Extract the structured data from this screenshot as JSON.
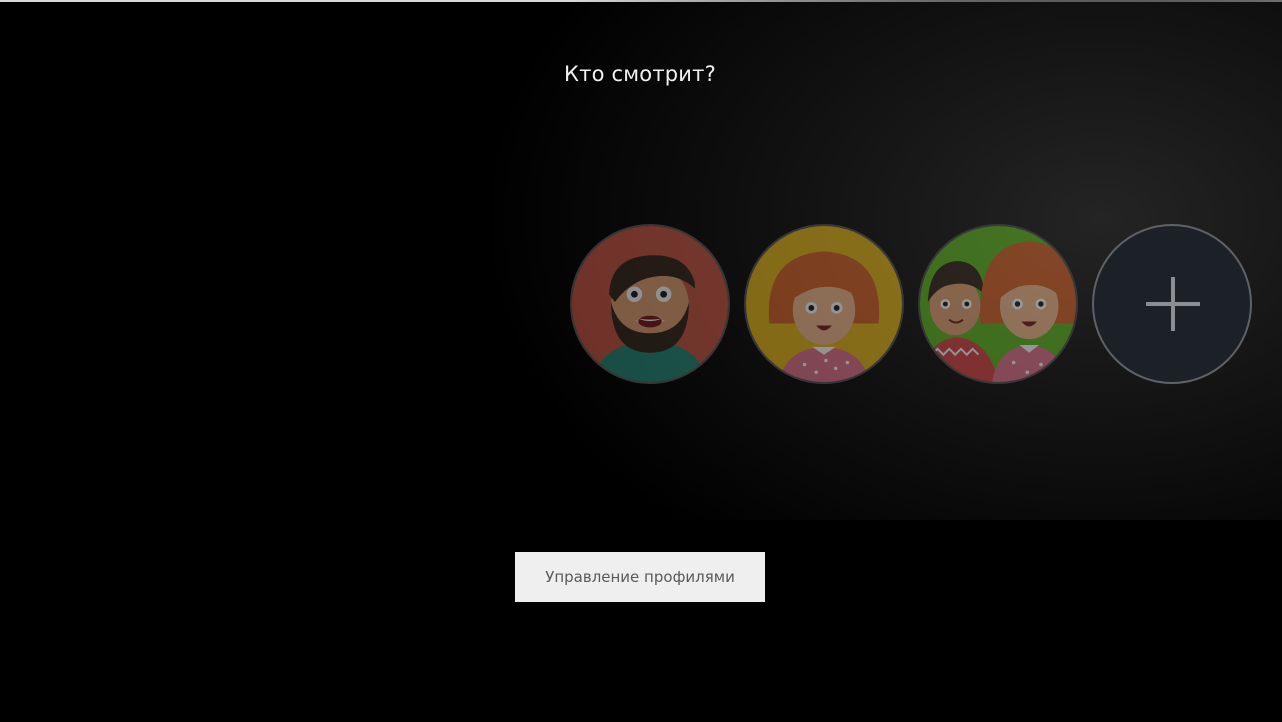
{
  "screen": {
    "title": "Кто смотрит?",
    "manage_button_label": "Управление профилями"
  },
  "profiles": [
    {
      "icon": "bearded-man-avatar-icon",
      "bg_color": "#b04a3c"
    },
    {
      "icon": "red-haired-woman-avatar-icon",
      "bg_color": "#c9a01a"
    },
    {
      "icon": "family-avatar-icon",
      "bg_color": "#4f9a20"
    }
  ],
  "add_profile": {
    "icon": "plus-icon"
  },
  "colors": {
    "background": "#000000",
    "title_text": "#f2f2f2",
    "button_bg": "#efefef",
    "button_text": "#5a5a5a",
    "add_circle_bg": "#1c2027"
  }
}
